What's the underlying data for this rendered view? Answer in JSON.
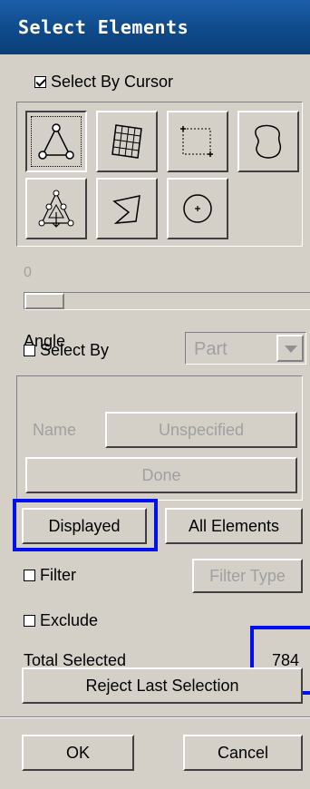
{
  "window": {
    "title": "Select Elements"
  },
  "select_by_cursor": {
    "label": "Select By Cursor",
    "checked": true
  },
  "tools": [
    {
      "name": "single-element-icon",
      "active": true
    },
    {
      "name": "surface-patch-icon",
      "active": false
    },
    {
      "name": "box-select-icon",
      "active": false
    },
    {
      "name": "freehand-region-icon",
      "active": false
    },
    {
      "name": "element-propagation-icon",
      "active": false
    },
    {
      "name": "polygon-select-icon",
      "active": false
    },
    {
      "name": "circle-select-icon",
      "active": false
    }
  ],
  "slider": {
    "value_label": "0",
    "value": 0
  },
  "angle_label": "Angle",
  "select_by": {
    "label": "Select By",
    "checked": false,
    "selected_option": "Part"
  },
  "name_row": {
    "label": "Name",
    "button": "Unspecified"
  },
  "done_button": "Done",
  "displayed_button": "Displayed",
  "all_elements_button": "All Elements",
  "filter": {
    "label": "Filter",
    "checked": false,
    "button": "Filter Type"
  },
  "exclude": {
    "label": "Exclude",
    "checked": false
  },
  "total_selected": {
    "label": "Total Selected",
    "value": "784"
  },
  "reject_button": "Reject Last Selection",
  "ok_button": "OK",
  "cancel_button": "Cancel",
  "colors": {
    "title_bar": "#0f4b8c",
    "panel": "#d4d0c8",
    "highlight": "#0010f0",
    "disabled_text": "#a0a0a0"
  }
}
